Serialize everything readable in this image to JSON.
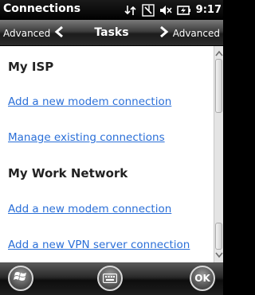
{
  "titlebar": {
    "app_title": "Connections",
    "clock": "9:17",
    "icons": [
      "data-connection-icon",
      "no-signal-icon",
      "volume-muted-icon",
      "battery-charging-icon"
    ]
  },
  "navbar": {
    "left_label": "Advanced",
    "title": "Tasks",
    "right_label": "Advanced"
  },
  "content": {
    "sections": [
      {
        "heading": "My ISP",
        "links": [
          "Add a new modem connection",
          "Manage existing connections"
        ]
      },
      {
        "heading": "My Work Network",
        "links": [
          "Add a new modem connection",
          "Add a new VPN server connection"
        ]
      }
    ]
  },
  "menubar": {
    "ok_label": "OK"
  },
  "colors": {
    "link": "#2a6fd8",
    "heading": "#222222",
    "background": "#ffffff"
  }
}
